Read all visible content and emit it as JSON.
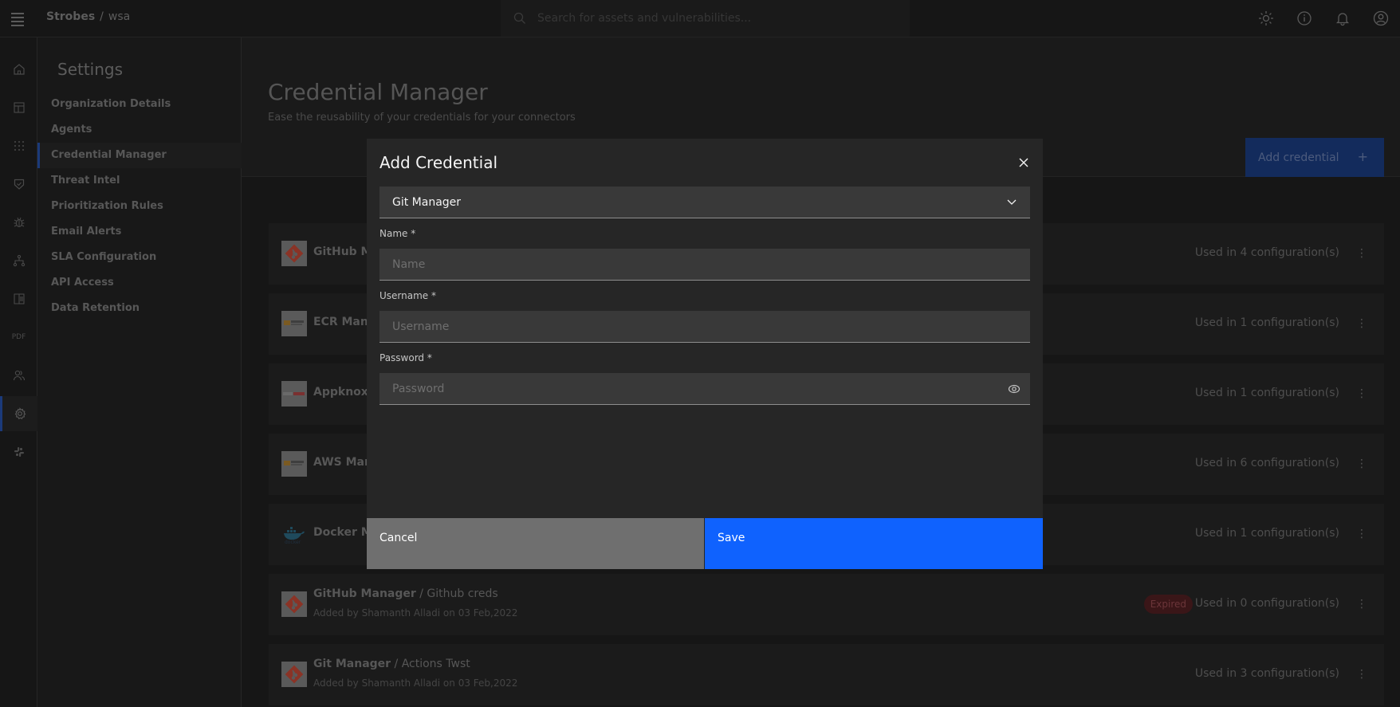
{
  "header": {
    "brand": "Strobes",
    "separator": "/",
    "workspace": "wsa",
    "search_placeholder": "Search for assets and vulnerabilities...",
    "icons": [
      "theme-toggle-icon",
      "info-icon",
      "notification-bell-icon",
      "user-avatar-icon"
    ]
  },
  "rail": {
    "items": [
      {
        "name": "home-icon"
      },
      {
        "name": "dashboard-icon"
      },
      {
        "name": "apps-grid-icon"
      },
      {
        "name": "shield-check-icon"
      },
      {
        "name": "bug-icon"
      },
      {
        "name": "network-icon"
      },
      {
        "name": "reports-icon"
      },
      {
        "name": "pdf-icon",
        "label": "PDF"
      },
      {
        "name": "users-icon"
      },
      {
        "name": "settings-gear-icon",
        "active": true
      },
      {
        "name": "integrations-icon"
      }
    ]
  },
  "sidebar": {
    "title": "Settings",
    "items": [
      {
        "label": "Organization Details"
      },
      {
        "label": "Agents"
      },
      {
        "label": "Credential Manager",
        "active": true
      },
      {
        "label": "Threat Intel"
      },
      {
        "label": "Prioritization Rules"
      },
      {
        "label": "Email Alerts"
      },
      {
        "label": "SLA Configuration"
      },
      {
        "label": "API Access"
      },
      {
        "label": "Data Retention"
      }
    ]
  },
  "page": {
    "title": "Credential Manager",
    "subtitle": "Ease the reusability of your credentials for your connectors",
    "add_button": "Add credential",
    "add_button_icon": "+"
  },
  "credentials": [
    {
      "manager": "GitHub Ma",
      "name": "",
      "added": "",
      "used": "Used in 4 configuration(s)",
      "logo": "git"
    },
    {
      "manager": "ECR Mana",
      "name": "",
      "added": "",
      "used": "Used in 1 configuration(s)",
      "logo": "aws"
    },
    {
      "manager": "Appknox N",
      "name": "",
      "added": "",
      "used": "Used in 1 configuration(s)",
      "logo": "appknox"
    },
    {
      "manager": "AWS Mana",
      "name": "",
      "added": "",
      "used": "Used in 6 configuration(s)",
      "logo": "aws"
    },
    {
      "manager": "Docker Ma",
      "name": "",
      "added": "",
      "used": "Used in 1 configuration(s)",
      "logo": "docker"
    },
    {
      "manager": "GitHub Manager",
      "name": " / Github creds",
      "added": "Added by Shamanth Alladi on 03 Feb,2022",
      "used": "Used in 0 configuration(s)",
      "badge": "Expired",
      "logo": "git"
    },
    {
      "manager": "Git Manager",
      "name": " / Actions Twst",
      "added": "Added by Shamanth Alladi on 03 Feb,2022",
      "used": "Used in 3 configuration(s)",
      "logo": "git"
    }
  ],
  "modal": {
    "title": "Add Credential",
    "type_select": "Git Manager",
    "fields": [
      {
        "label": "Name *",
        "placeholder": "Name",
        "value": ""
      },
      {
        "label": "Username *",
        "placeholder": "Username",
        "value": ""
      },
      {
        "label": "Password *",
        "placeholder": "Password",
        "value": ""
      }
    ],
    "cancel": "Cancel",
    "save": "Save"
  },
  "colors": {
    "primary": "#0f62fe",
    "modal_bg": "#262626",
    "field_bg": "#393939",
    "cancel_bg": "#6f6f6f",
    "expired_badge": "#3a1618"
  }
}
